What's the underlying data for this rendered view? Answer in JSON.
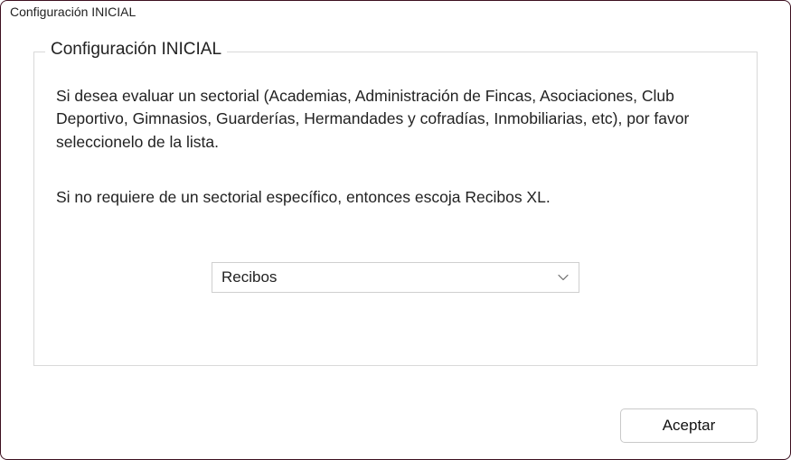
{
  "window": {
    "title": "Configuración INICIAL"
  },
  "fieldset": {
    "legend": "Configuración INICIAL",
    "paragraph1": "Si desea evaluar un sectorial (Academias, Administración de Fincas, Asociaciones, Club Deportivo, Gimnasios, Guarderías, Hermandades y cofradías, Inmobiliarias, etc), por favor seleccionelo de la lista.",
    "paragraph2": "Si no requiere de un sectorial específico, entonces escoja Recibos XL."
  },
  "select": {
    "value": "Recibos"
  },
  "buttons": {
    "accept": "Aceptar"
  }
}
